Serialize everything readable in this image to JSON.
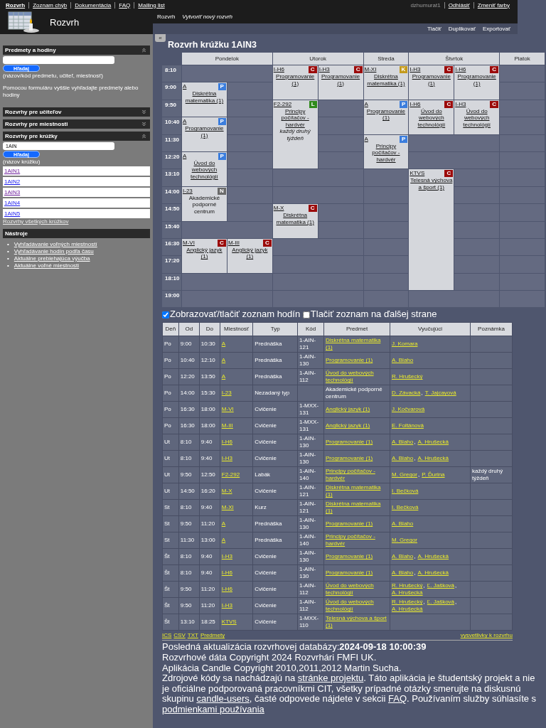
{
  "header": {
    "nav": [
      {
        "label": "Rozvrh",
        "selected": true
      },
      {
        "label": "Zoznam chýb",
        "selected": false
      },
      {
        "label": "Dokumentácia",
        "selected": false
      },
      {
        "label": "FAQ",
        "selected": false
      },
      {
        "label": "Mailing list",
        "selected": false
      }
    ],
    "user": "dzhumurat1",
    "user_links": [
      "Odhlásiť",
      "Zmeniť farby"
    ],
    "app_title": "Rozvrh",
    "breadcrumbs": [
      {
        "label": "Rozvrh",
        "kind": "current"
      },
      {
        "label": "Vytvoriť nový rozvrh",
        "kind": "action"
      }
    ],
    "actions": [
      "Tlačiť",
      "Duplikovať",
      "Exportovať"
    ]
  },
  "sidebar": {
    "sections": [
      {
        "kind": "search",
        "title": "Predmety a hodiny",
        "expanded": true,
        "button": "Hľadaj",
        "hint": "(názov/kód predmetu, učiteľ, miestnosť)",
        "help": "Pomocou formuláru vyššie vyhľadajte predmety alebo hodiny"
      },
      {
        "kind": "search",
        "title": "Rozvrhy pre učiteľov",
        "expanded": false
      },
      {
        "kind": "search",
        "title": "Rozvrhy pre miestnosti",
        "expanded": false
      },
      {
        "kind": "search",
        "title": "Rozvrhy pre krúžky",
        "expanded": true,
        "value": "1AIN",
        "button": "Hľadaj",
        "hint": "(názov krúžku)",
        "results": [
          {
            "label": "1AIN1",
            "visited": true
          },
          {
            "label": "1AIN2",
            "visited": false
          },
          {
            "label": "1AIN3",
            "visited": true
          },
          {
            "label": "1AIN4",
            "visited": false
          },
          {
            "label": "1AIN5",
            "visited": false
          }
        ],
        "more_link": "Rozvrhy všetkých krúžkov"
      },
      {
        "kind": "tools",
        "title": "Nástroje",
        "links": [
          {
            "bullet": "•",
            "label": "Vyhľadávanie voľných miestností"
          },
          {
            "bullet": "•",
            "label": "Vyhľadávanie hodín podľa času"
          },
          {
            "bullet": "•",
            "label": "Aktuálne prebiehajúca výučba"
          },
          {
            "bullet": "•",
            "label": "Aktuálne voľné miestnosti"
          }
        ]
      }
    ]
  },
  "collapse_button": "«",
  "title": "Rozvrh krúžku 1AIN3",
  "timetable": {
    "times": [
      "8:10",
      "9:00",
      "9:50",
      "10:40",
      "11:30",
      "12:20",
      "13:10",
      "14:00",
      "14:50",
      "15:40",
      "16:30",
      "17:20",
      "18:10",
      "19:00"
    ],
    "days": [
      {
        "name": "Pondelok",
        "columns": [
          [
            {
              "kind": "free"
            },
            {
              "kind": "lesson",
              "room": "A",
              "type": "P",
              "color": "#3b7ddd",
              "subject": "Diskrétna matematika (1)",
              "linked": true
            },
            {
              "kind": "cont"
            },
            {
              "kind": "lesson",
              "room": "A",
              "type": "P",
              "color": "#3b7ddd",
              "subject": "Programovanie (1)",
              "linked": true
            },
            {
              "kind": "cont"
            },
            {
              "kind": "lesson",
              "room": "A",
              "type": "P",
              "color": "#3b7ddd",
              "subject": "Úvod do webových technológií",
              "linked": true
            },
            {
              "kind": "cont"
            },
            {
              "kind": "lesson",
              "room": "I-23",
              "type": "N",
              "color": "#6a6a6a",
              "subject": "Akademické podporné centrum",
              "linked": false
            },
            {
              "kind": "cont"
            },
            {
              "kind": "free"
            },
            {
              "kind": "lesson",
              "room": "M-VI",
              "type": "C",
              "color": "#9b0a0a",
              "subject": "Anglický jazyk (1)",
              "linked": true
            },
            {
              "kind": "cont"
            },
            {
              "kind": "free"
            },
            {
              "kind": "free"
            }
          ],
          [
            {
              "kind": "free"
            },
            {
              "kind": "free"
            },
            {
              "kind": "free"
            },
            {
              "kind": "free"
            },
            {
              "kind": "free"
            },
            {
              "kind": "free"
            },
            {
              "kind": "free"
            },
            {
              "kind": "free"
            },
            {
              "kind": "free"
            },
            {
              "kind": "free"
            },
            {
              "kind": "lesson",
              "room": "M-III",
              "type": "C",
              "color": "#9b0a0a",
              "subject": "Anglický jazyk (1)",
              "linked": true
            },
            {
              "kind": "cont"
            },
            {
              "kind": "free"
            },
            {
              "kind": "free"
            }
          ]
        ]
      },
      {
        "name": "Utorok",
        "columns": [
          [
            {
              "kind": "lesson",
              "room": "I-H6",
              "type": "C",
              "color": "#9b0a0a",
              "subject": "Programovanie (1)",
              "linked": true
            },
            {
              "kind": "cont"
            },
            {
              "kind": "lesson",
              "room": "F2-292",
              "type": "L",
              "color": "#2f8a1c",
              "subject": "Principy počítačov - hardvér",
              "linked": true,
              "note": "každý druhý týždeň"
            },
            {
              "kind": "cont"
            },
            {
              "kind": "cont"
            },
            {
              "kind": "cont"
            },
            {
              "kind": "free"
            },
            {
              "kind": "free"
            },
            {
              "kind": "lesson",
              "room": "M-X",
              "type": "C",
              "color": "#9b0a0a",
              "subject": "Diskrétna matematika (1)",
              "linked": true
            },
            {
              "kind": "cont"
            },
            {
              "kind": "free"
            },
            {
              "kind": "free"
            },
            {
              "kind": "free"
            },
            {
              "kind": "free"
            }
          ],
          [
            {
              "kind": "lesson",
              "room": "I-H3",
              "type": "C",
              "color": "#9b0a0a",
              "subject": "Programovanie (1)",
              "linked": true
            },
            {
              "kind": "cont"
            },
            {
              "kind": "free"
            },
            {
              "kind": "free"
            },
            {
              "kind": "free"
            },
            {
              "kind": "free"
            },
            {
              "kind": "free"
            },
            {
              "kind": "free"
            },
            {
              "kind": "free"
            },
            {
              "kind": "free"
            },
            {
              "kind": "free"
            },
            {
              "kind": "free"
            },
            {
              "kind": "free"
            },
            {
              "kind": "free"
            }
          ]
        ]
      },
      {
        "name": "Streda",
        "columns": [
          [
            {
              "kind": "lesson",
              "room": "M-XI",
              "type": "K",
              "color": "#c49a1c",
              "subject": "Diskrétna matematika (1)",
              "linked": true
            },
            {
              "kind": "cont"
            },
            {
              "kind": "lesson",
              "room": "A",
              "type": "P",
              "color": "#3b7ddd",
              "subject": "Programovanie (1)",
              "linked": true
            },
            {
              "kind": "cont"
            },
            {
              "kind": "lesson",
              "room": "A",
              "type": "P",
              "color": "#3b7ddd",
              "subject": "Principy počítačov - hardvér",
              "linked": true
            },
            {
              "kind": "cont"
            },
            {
              "kind": "free"
            },
            {
              "kind": "free"
            },
            {
              "kind": "free"
            },
            {
              "kind": "free"
            },
            {
              "kind": "free"
            },
            {
              "kind": "free"
            },
            {
              "kind": "free"
            },
            {
              "kind": "free"
            }
          ]
        ]
      },
      {
        "name": "Štvrtok",
        "columns": [
          [
            {
              "kind": "lesson",
              "room": "I-H3",
              "type": "C",
              "color": "#9b0a0a",
              "subject": "Programovanie (1)",
              "linked": true
            },
            {
              "kind": "cont"
            },
            {
              "kind": "lesson",
              "room": "I-H6",
              "type": "C",
              "color": "#9b0a0a",
              "subject": "Úvod do webových technológií",
              "linked": true
            },
            {
              "kind": "cont"
            },
            {
              "kind": "free"
            },
            {
              "kind": "free"
            },
            {
              "kind": "lesson",
              "room": "KTVS",
              "type": "C",
              "color": "#9b0a0a",
              "subject": "Telesná výchova a šport (1)",
              "linked": true
            },
            {
              "kind": "cont"
            },
            {
              "kind": "cont"
            },
            {
              "kind": "cont"
            },
            {
              "kind": "cont"
            },
            {
              "kind": "cont"
            },
            {
              "kind": "cont"
            },
            {
              "kind": "free"
            }
          ],
          [
            {
              "kind": "lesson",
              "room": "I-H6",
              "type": "C",
              "color": "#9b0a0a",
              "subject": "Programovanie (1)",
              "linked": true
            },
            {
              "kind": "cont"
            },
            {
              "kind": "lesson",
              "room": "I-H3",
              "type": "C",
              "color": "#9b0a0a",
              "subject": "Úvod do webových technológií",
              "linked": true
            },
            {
              "kind": "cont"
            },
            {
              "kind": "free"
            },
            {
              "kind": "free"
            },
            {
              "kind": "free"
            },
            {
              "kind": "free"
            },
            {
              "kind": "free"
            },
            {
              "kind": "free"
            },
            {
              "kind": "free"
            },
            {
              "kind": "free"
            },
            {
              "kind": "free"
            },
            {
              "kind": "free"
            }
          ]
        ]
      },
      {
        "name": "Piatok",
        "columns": [
          [
            {
              "kind": "free"
            },
            {
              "kind": "free"
            },
            {
              "kind": "free"
            },
            {
              "kind": "free"
            },
            {
              "kind": "free"
            },
            {
              "kind": "free"
            },
            {
              "kind": "free"
            },
            {
              "kind": "free"
            },
            {
              "kind": "free"
            },
            {
              "kind": "free"
            },
            {
              "kind": "free"
            },
            {
              "kind": "free"
            },
            {
              "kind": "free"
            },
            {
              "kind": "free"
            }
          ]
        ]
      }
    ]
  },
  "options": [
    {
      "label": "Zobrazovať/tlačiť zoznam hodín",
      "checked": true
    },
    {
      "label": "Tlačiť zoznam na ďalšej strane",
      "checked": false
    }
  ],
  "lessons": {
    "columns": [
      "Deň",
      "Od",
      "Do",
      "Miestnosť",
      "Typ",
      "Kód",
      "Predmet",
      "Vyučujúci",
      "Poznámka"
    ],
    "rows": [
      {
        "day": "Po",
        "from": "9:00",
        "to": "10:30",
        "room": "A",
        "type": "Prednáška",
        "code": "1-AIN-121",
        "subject": "Diskrétna matematika (1)",
        "linked": true,
        "teachers": [
          {
            "name": "J. Komara"
          }
        ]
      },
      {
        "day": "Po",
        "from": "10:40",
        "to": "12:10",
        "room": "A",
        "type": "Prednáška",
        "code": "1-AIN-130",
        "subject": "Programovanie (1)",
        "linked": true,
        "teachers": [
          {
            "name": "A. Blaho"
          }
        ]
      },
      {
        "day": "Po",
        "from": "12:20",
        "to": "13:50",
        "room": "A",
        "type": "Prednáška",
        "code": "1-AIN-112",
        "subject": "Úvod do webových technológií",
        "linked": true,
        "teachers": [
          {
            "name": "R. Hrušecký"
          }
        ]
      },
      {
        "day": "Po",
        "from": "14:00",
        "to": "15:30",
        "room": "I-23",
        "type": "Nezadaný typ",
        "subject": "Akademické podporné centrum",
        "linked": false,
        "teachers": [
          {
            "name": "D. Závacká",
            "separator": ","
          },
          {
            "name": "T. Jajcayová"
          }
        ]
      },
      {
        "day": "Po",
        "from": "16:30",
        "to": "18:00",
        "room": "M-VI",
        "type": "Cvičenie",
        "code": "1-MXX-131",
        "subject": "Anglický jazyk (1)",
        "linked": true,
        "teachers": [
          {
            "name": "J. Kočvarová"
          }
        ]
      },
      {
        "day": "Po",
        "from": "16:30",
        "to": "18:00",
        "room": "M-III",
        "type": "Cvičenie",
        "code": "1-MXX-131",
        "subject": "Anglický jazyk (1)",
        "linked": true,
        "teachers": [
          {
            "name": "E. Foltánová"
          }
        ]
      },
      {
        "day": "Ut",
        "from": "8:10",
        "to": "9:40",
        "room": "I-H6",
        "type": "Cvičenie",
        "code": "1-AIN-130",
        "subject": "Programovanie (1)",
        "linked": true,
        "teachers": [
          {
            "name": "A. Blaho",
            "separator": ","
          },
          {
            "name": "A. Hrušecká"
          }
        ]
      },
      {
        "day": "Ut",
        "from": "8:10",
        "to": "9:40",
        "room": "I-H3",
        "type": "Cvičenie",
        "code": "1-AIN-130",
        "subject": "Programovanie (1)",
        "linked": true,
        "teachers": [
          {
            "name": "A. Blaho",
            "separator": ","
          },
          {
            "name": "A. Hrušecká"
          }
        ]
      },
      {
        "day": "Ut",
        "from": "9:50",
        "to": "12:50",
        "room": "F2-292",
        "type": "Labák",
        "code": "1-AIN-140",
        "subject": "Principy počítačov - hardvér",
        "linked": true,
        "teachers": [
          {
            "name": "M. Gregor",
            "separator": ","
          },
          {
            "name": "P. Ďurina"
          }
        ],
        "note": "každý druhý týždeň"
      },
      {
        "day": "Ut",
        "from": "14:50",
        "to": "16:20",
        "room": "M-X",
        "type": "Cvičenie",
        "code": "1-AIN-121",
        "subject": "Diskrétna matematika (1)",
        "linked": true,
        "teachers": [
          {
            "name": "I. Bečková"
          }
        ]
      },
      {
        "day": "St",
        "from": "8:10",
        "to": "9:40",
        "room": "M-XI",
        "type": "Kurz",
        "code": "1-AIN-121",
        "subject": "Diskrétna matematika (1)",
        "linked": true,
        "teachers": [
          {
            "name": "I. Bečková"
          }
        ]
      },
      {
        "day": "St",
        "from": "9:50",
        "to": "11:20",
        "room": "A",
        "type": "Prednáška",
        "code": "1-AIN-130",
        "subject": "Programovanie (1)",
        "linked": true,
        "teachers": [
          {
            "name": "A. Blaho"
          }
        ]
      },
      {
        "day": "St",
        "from": "11:30",
        "to": "13:00",
        "room": "A",
        "type": "Prednáška",
        "code": "1-AIN-140",
        "subject": "Principy počítačov - hardvér",
        "linked": true,
        "teachers": [
          {
            "name": "M. Gregor"
          }
        ]
      },
      {
        "day": "Št",
        "from": "8:10",
        "to": "9:40",
        "room": "I-H3",
        "type": "Cvičenie",
        "code": "1-AIN-130",
        "subject": "Programovanie (1)",
        "linked": true,
        "teachers": [
          {
            "name": "A. Blaho",
            "separator": ","
          },
          {
            "name": "A. Hrušecká"
          }
        ]
      },
      {
        "day": "Št",
        "from": "8:10",
        "to": "9:40",
        "room": "I-H6",
        "type": "Cvičenie",
        "code": "1-AIN-130",
        "subject": "Programovanie (1)",
        "linked": true,
        "teachers": [
          {
            "name": "A. Blaho",
            "separator": ","
          },
          {
            "name": "A. Hrušecká"
          }
        ]
      },
      {
        "day": "Št",
        "from": "9:50",
        "to": "11:20",
        "room": "I-H6",
        "type": "Cvičenie",
        "code": "1-AIN-112",
        "subject": "Úvod do webových technológií",
        "linked": true,
        "teachers": [
          {
            "name": "R. Hrušecký",
            "separator": ","
          },
          {
            "name": "Ľ. Jašková",
            "separator": ","
          },
          {
            "name": "A. Hrušecká"
          }
        ]
      },
      {
        "day": "Št",
        "from": "9:50",
        "to": "11:20",
        "room": "I-H3",
        "type": "Cvičenie",
        "code": "1-AIN-112",
        "subject": "Úvod do webových technológií",
        "linked": true,
        "teachers": [
          {
            "name": "R. Hrušecký",
            "separator": ","
          },
          {
            "name": "Ľ. Jašková",
            "separator": ","
          },
          {
            "name": "A. Hrušecká"
          }
        ]
      },
      {
        "day": "Št",
        "from": "13:10",
        "to": "18:25",
        "room": "KTVS",
        "type": "Cvičenie",
        "code": "1-MXX-110",
        "subject": "Telesná výchova a šport (1)",
        "linked": true
      }
    ]
  },
  "export_links": [
    "ICS",
    "CSV",
    "TXT",
    "Predmety"
  ],
  "legend_link": "vysvetlivky k rozvrhu",
  "footer": [
    [
      {
        "text": "Posledná aktualizácia rozvrhovej databázy:**2024-09-18 10:00:39**",
        "link": false
      }
    ],
    [
      {
        "text": "Rozvrhové dáta Copyright 2024 Rozvrhári FMFI UK.",
        "link": false
      }
    ],
    [
      {
        "text": "Aplikácia Candle Copyright 2010,2011,2012 Martin Sucha.",
        "link": false
      }
    ],
    [
      {
        "text": "Zdrojové kódy sa nachádzajú na ",
        "link": false
      },
      {
        "text": "stránke projektu",
        "link": true
      },
      {
        "text": ". Táto aplikácia je študentský projekt a nie je oficiálne podporovaná pracovníkmi CIT, všetky prípadné otázky smerujte na diskusnú skupinu ",
        "link": false
      },
      {
        "text": "candle-users",
        "link": true
      },
      {
        "text": ", časté odpovede nájdete v sekcii ",
        "link": false
      },
      {
        "text": "FAQ",
        "link": true
      },
      {
        "text": ". Používaním služby súhlasíte s ",
        "link": false
      },
      {
        "text": "podmienkami používania",
        "link": true
      }
    ]
  ]
}
